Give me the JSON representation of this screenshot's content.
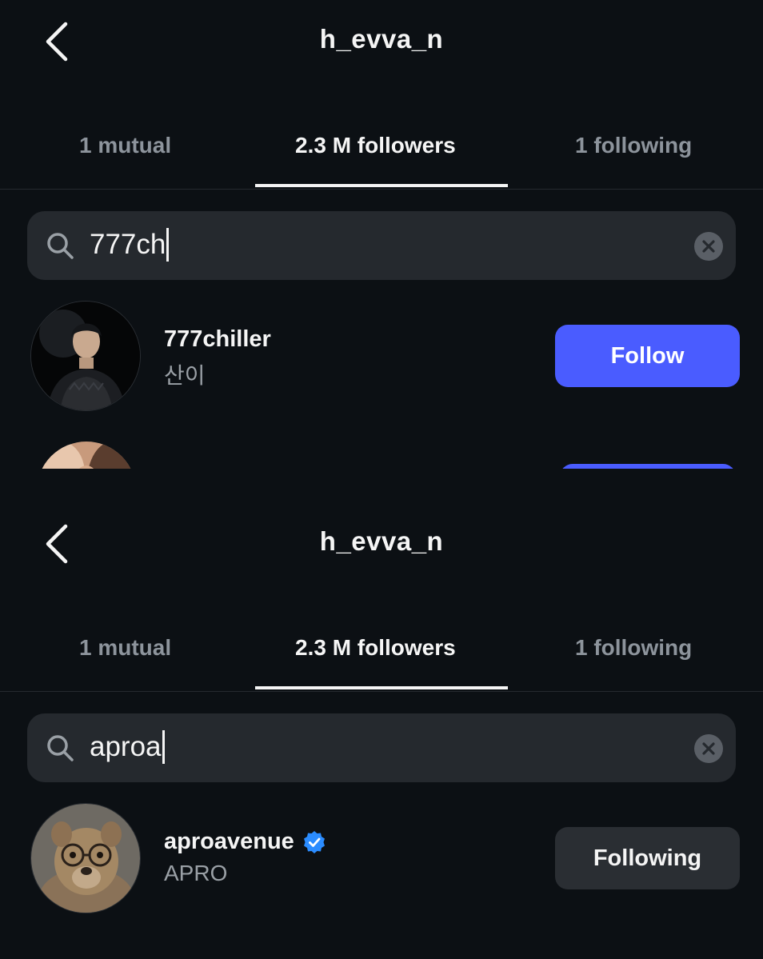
{
  "colors": {
    "background": "#0c1014",
    "accent_follow": "#4a5cff",
    "verified": "#2b8cff",
    "muted_text": "#9aa0a6"
  },
  "panels": [
    {
      "header": {
        "title": "h_evva_n",
        "back_icon": "chevron-left-icon"
      },
      "tabs": [
        {
          "label": "1 mutual",
          "active": false
        },
        {
          "label": "2.3 M followers",
          "active": true
        },
        {
          "label": "1 following",
          "active": false
        }
      ],
      "search": {
        "value": "777ch",
        "icon": "search-icon",
        "clear_icon": "close-icon"
      },
      "result": {
        "username": "777chiller",
        "full_name": "산이",
        "verified": false,
        "button_label": "Follow"
      }
    },
    {
      "header": {
        "title": "h_evva_n",
        "back_icon": "chevron-left-icon"
      },
      "tabs": [
        {
          "label": "1 mutual",
          "active": false
        },
        {
          "label": "2.3 M followers",
          "active": true
        },
        {
          "label": "1 following",
          "active": false
        }
      ],
      "search": {
        "value": "aproa",
        "icon": "search-icon",
        "clear_icon": "close-icon"
      },
      "result": {
        "username": "aproavenue",
        "full_name": "APRO",
        "verified": true,
        "button_label": "Following"
      }
    }
  ]
}
